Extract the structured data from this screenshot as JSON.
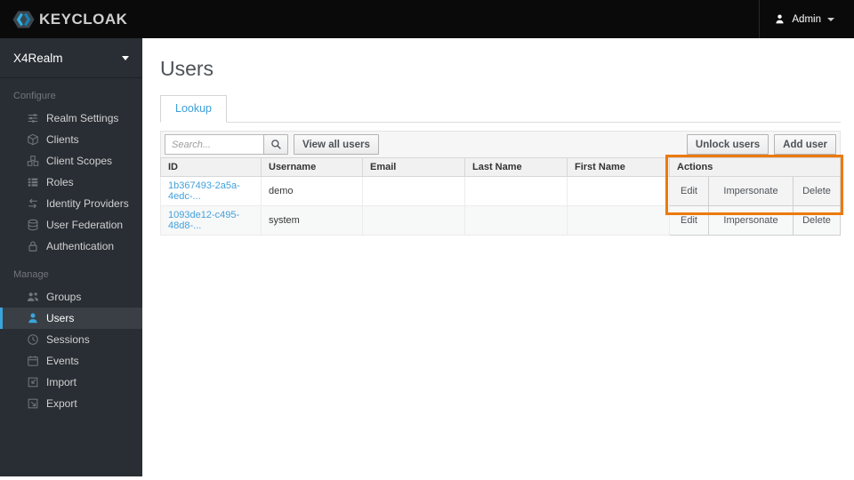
{
  "topbar": {
    "brand": "KEYCLOAK",
    "user_label": "Admin"
  },
  "sidebar": {
    "realm": "X4Realm",
    "sections": [
      {
        "label": "Configure",
        "items": [
          {
            "label": "Realm Settings",
            "icon": "sliders-icon"
          },
          {
            "label": "Clients",
            "icon": "cube-icon"
          },
          {
            "label": "Client Scopes",
            "icon": "cubes-icon"
          },
          {
            "label": "Roles",
            "icon": "list-icon"
          },
          {
            "label": "Identity Providers",
            "icon": "exchange-icon"
          },
          {
            "label": "User Federation",
            "icon": "database-icon"
          },
          {
            "label": "Authentication",
            "icon": "lock-icon"
          }
        ]
      },
      {
        "label": "Manage",
        "items": [
          {
            "label": "Groups",
            "icon": "group-icon"
          },
          {
            "label": "Users",
            "icon": "user-icon",
            "active": true
          },
          {
            "label": "Sessions",
            "icon": "clock-icon"
          },
          {
            "label": "Events",
            "icon": "calendar-icon"
          },
          {
            "label": "Import",
            "icon": "import-icon"
          },
          {
            "label": "Export",
            "icon": "export-icon"
          }
        ]
      }
    ]
  },
  "main": {
    "title": "Users",
    "tabs": [
      {
        "label": "Lookup",
        "active": true
      }
    ],
    "toolbar": {
      "search_placeholder": "Search...",
      "search_value": "",
      "view_all_label": "View all users",
      "unlock_label": "Unlock users",
      "add_label": "Add user"
    },
    "table": {
      "columns": [
        "ID",
        "Username",
        "Email",
        "Last Name",
        "First Name",
        "Actions"
      ],
      "rows": [
        {
          "id": "1b367493-2a5a-4edc-...",
          "username": "demo",
          "email": "",
          "last_name": "",
          "first_name": "",
          "actions": [
            "Edit",
            "Impersonate",
            "Delete"
          ]
        },
        {
          "id": "1093de12-c495-48d8-...",
          "username": "system",
          "email": "",
          "last_name": "",
          "first_name": "",
          "actions": [
            "Edit",
            "Impersonate",
            "Delete"
          ]
        }
      ]
    },
    "annotation": {
      "target": "actions-column",
      "color": "#ec7a08"
    }
  },
  "colors": {
    "topbar_bg": "#0a0a0a",
    "sidebar_bg": "#292e34",
    "accent_blue": "#39a5dc",
    "link_blue": "#43a1da",
    "annotation_orange": "#ec7a08"
  }
}
